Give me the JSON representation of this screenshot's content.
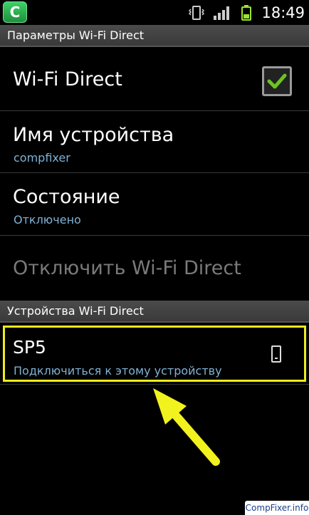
{
  "status_bar": {
    "app_icon_letter": "C",
    "time": "18:49",
    "icons": [
      "vibrate-icon",
      "signal-icon",
      "battery-icon"
    ]
  },
  "sections": {
    "settings_header": "Параметры Wi-Fi Direct",
    "devices_header": "Устройства Wi-Fi Direct"
  },
  "settings": {
    "wifi_direct": {
      "label": "Wi-Fi Direct",
      "checked": true
    },
    "device_name": {
      "label": "Имя устройства",
      "value": "compfixer"
    },
    "status": {
      "label": "Состояние",
      "value": "Отключено"
    },
    "disconnect": {
      "label": "Отключить Wi-Fi Direct",
      "enabled": false
    }
  },
  "devices": [
    {
      "name": "SP5",
      "action": "Подключиться к этому устройству",
      "icon": "phone-icon"
    }
  ],
  "watermark": "CompFixer.info",
  "colors": {
    "highlight": "#ecec20",
    "accent_text": "#7fb2d6",
    "check": "#6cc323"
  }
}
